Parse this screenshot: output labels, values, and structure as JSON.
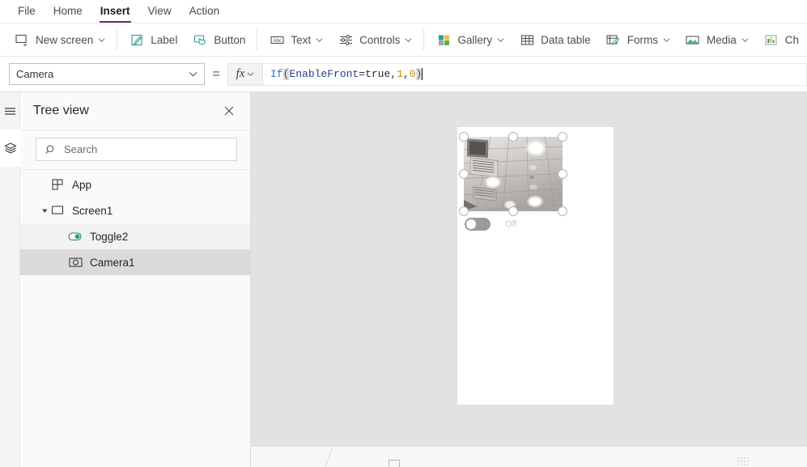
{
  "menubar": {
    "tabs": [
      {
        "label": "File",
        "active": false
      },
      {
        "label": "Home",
        "active": false
      },
      {
        "label": "Insert",
        "active": true
      },
      {
        "label": "View",
        "active": false
      },
      {
        "label": "Action",
        "active": false
      }
    ],
    "active_underline_color": "#742774"
  },
  "ribbon": {
    "items": [
      {
        "label": "New screen",
        "icon": "new-screen-icon",
        "caret": true
      },
      {
        "label": "Label",
        "icon": "label-icon",
        "caret": false
      },
      {
        "label": "Button",
        "icon": "button-icon",
        "caret": false
      },
      {
        "label": "Text",
        "icon": "text-icon",
        "caret": true
      },
      {
        "label": "Controls",
        "icon": "controls-icon",
        "caret": true
      },
      {
        "label": "Gallery",
        "icon": "gallery-icon",
        "caret": true
      },
      {
        "label": "Data table",
        "icon": "data-table-icon",
        "caret": false
      },
      {
        "label": "Forms",
        "icon": "forms-icon",
        "caret": true
      },
      {
        "label": "Media",
        "icon": "media-icon",
        "caret": true
      },
      {
        "label": "Ch",
        "icon": "charts-icon",
        "caret": false
      }
    ],
    "accent_color": "#2c9a8f"
  },
  "formula_bar": {
    "property": "Camera",
    "equals": "=",
    "fx_label": "fx",
    "formula_raw": "If(EnableFront=true,1,0)",
    "tokens": [
      {
        "text": "If",
        "kind": "fn"
      },
      {
        "text": "(",
        "kind": "paren"
      },
      {
        "text": "EnableFront",
        "kind": "ident"
      },
      {
        "text": "=",
        "kind": "op"
      },
      {
        "text": "true",
        "kind": "op"
      },
      {
        "text": ",",
        "kind": "punct"
      },
      {
        "text": "1",
        "kind": "num"
      },
      {
        "text": ",",
        "kind": "punct"
      },
      {
        "text": "0",
        "kind": "num"
      },
      {
        "text": ")",
        "kind": "paren"
      }
    ]
  },
  "rail": {
    "buttons": [
      {
        "icon": "hamburger-menu-icon",
        "active": false
      },
      {
        "icon": "tree-layers-icon",
        "active": true
      }
    ]
  },
  "tree_view": {
    "title": "Tree view",
    "close_icon": "close-icon",
    "search": {
      "placeholder": "Search",
      "value": "",
      "icon": "search-icon"
    },
    "items": [
      {
        "label": "App",
        "icon": "app-icon",
        "indent": 0,
        "expander": "none",
        "state": "normal"
      },
      {
        "label": "Screen1",
        "icon": "screen-icon",
        "indent": 0,
        "expander": "expanded",
        "state": "normal"
      },
      {
        "label": "Toggle2",
        "icon": "toggle-icon",
        "indent": 1,
        "expander": "none",
        "state": "shade"
      },
      {
        "label": "Camera1",
        "icon": "camera-icon",
        "indent": 1,
        "expander": "none",
        "state": "selected"
      }
    ]
  },
  "canvas": {
    "background_color": "#e2e2e2",
    "screen_background": "#ffffff",
    "camera_control": {
      "name": "Camera1",
      "selected": true,
      "handle_count": 8,
      "image_description": "ceiling tiles with recessed lights and an air vent"
    },
    "toggle_control": {
      "name": "Toggle2",
      "value_label": "Off",
      "checked": false,
      "track_color": "#9b9b9b"
    }
  }
}
